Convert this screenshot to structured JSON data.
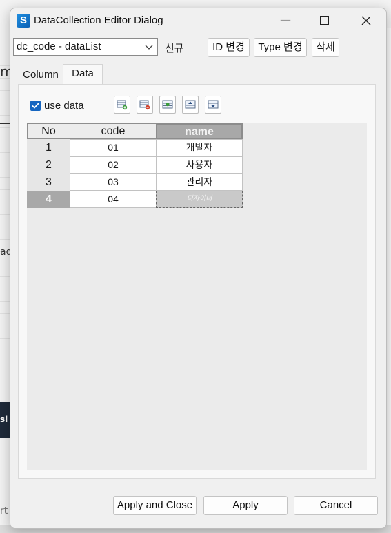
{
  "window": {
    "title": "DataCollection Editor Dialog",
    "app_icon_letter": "S"
  },
  "background": {
    "frag_m": "m",
    "frag_ad": "ad",
    "frag_si": "si",
    "frag_rt": "rt"
  },
  "toolbar": {
    "collection_select": "dc_code - dataList",
    "new_label": "신규",
    "change_id_label": "ID 변경",
    "change_type_label": "Type 변경",
    "delete_label": "삭제"
  },
  "tabs": [
    {
      "label": "Column"
    },
    {
      "label": "Data"
    }
  ],
  "data_tab": {
    "use_data": {
      "label": "use data",
      "checked": true
    },
    "tools": [
      "add-row-icon",
      "remove-row-icon",
      "insert-row-icon",
      "move-up-icon",
      "move-down-icon"
    ],
    "table": {
      "columns": [
        "No",
        "code",
        "name"
      ],
      "rows": [
        {
          "no": "1",
          "code": "01",
          "name": "개발자"
        },
        {
          "no": "2",
          "code": "02",
          "name": "사용자"
        },
        {
          "no": "3",
          "code": "03",
          "name": "관리자"
        },
        {
          "no": "4",
          "code": "04",
          "name": "디자이너"
        }
      ]
    }
  },
  "footer": {
    "apply_close_label": "Apply and Close",
    "apply_label": "Apply",
    "cancel_label": "Cancel"
  },
  "colors": {
    "accent": "#1565c0",
    "selected_header": "#a8a8a8"
  }
}
